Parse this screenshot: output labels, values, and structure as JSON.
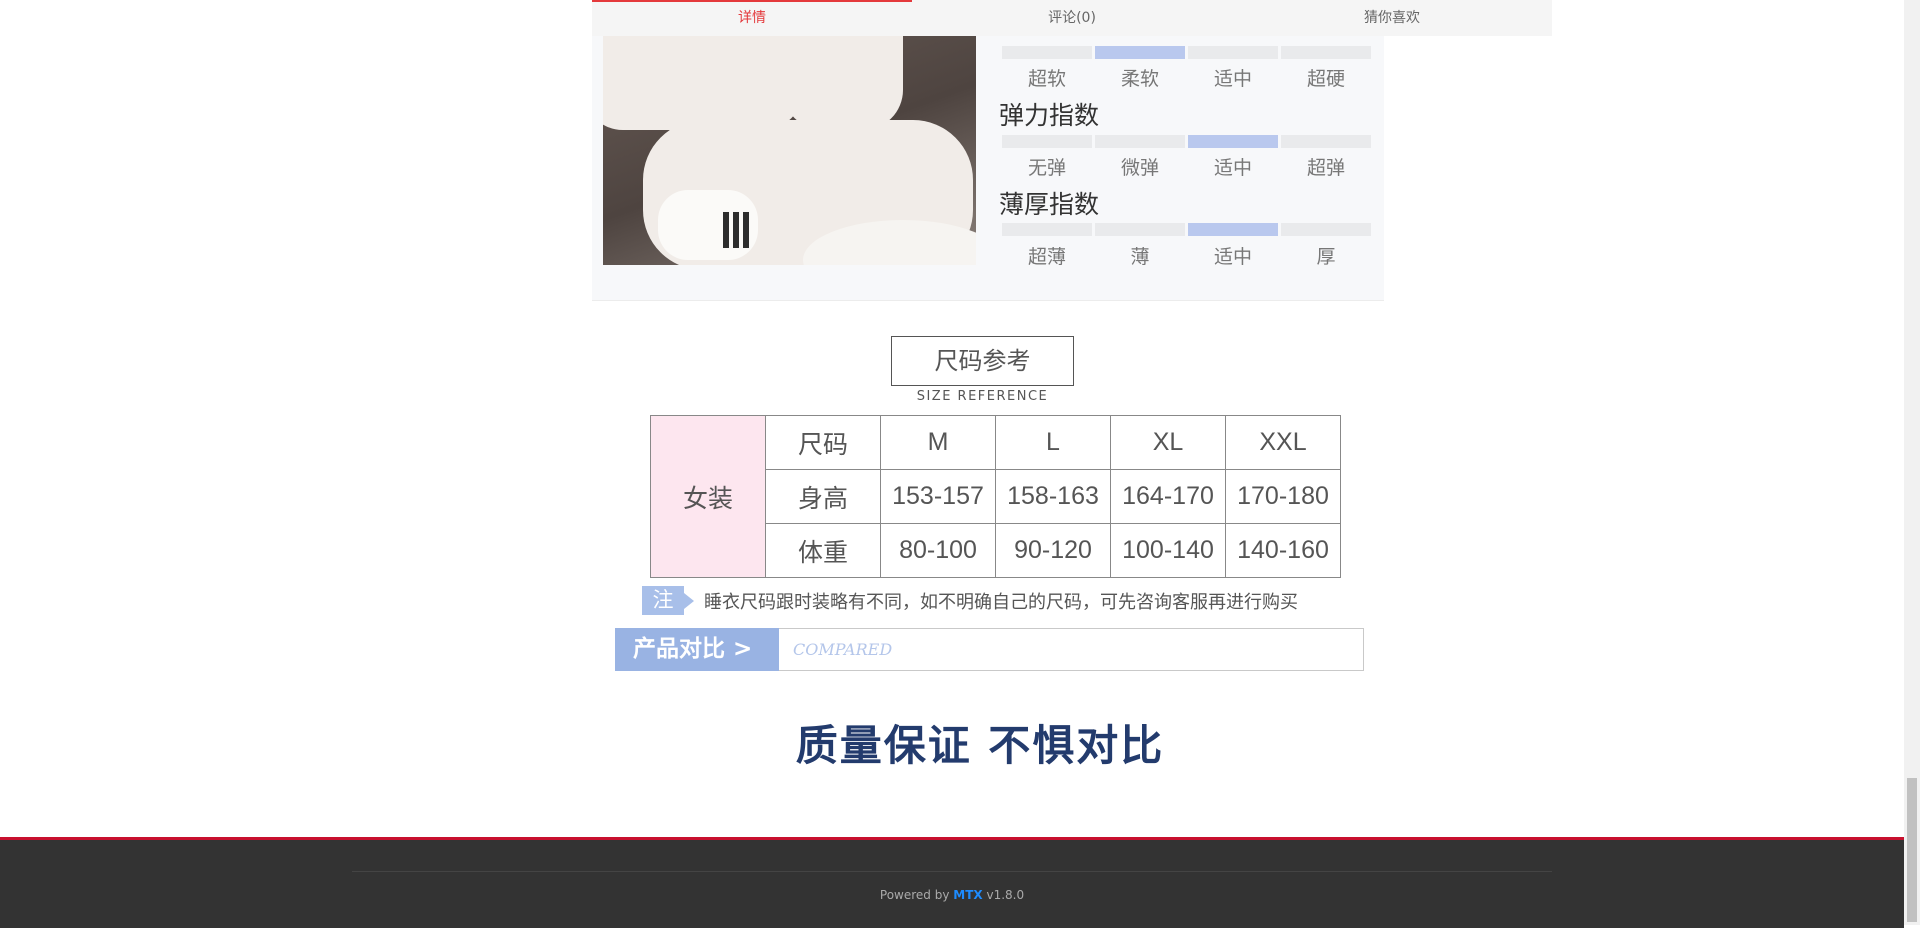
{
  "tabs": [
    {
      "label": "详情",
      "active": true
    },
    {
      "label": "评论(0)",
      "active": false
    },
    {
      "label": "猜你喜欢",
      "active": false
    }
  ],
  "indices": [
    {
      "title": "",
      "levels": [
        "超软",
        "柔软",
        "适中",
        "超硬"
      ],
      "selected": 1
    },
    {
      "title": "弹力指数",
      "levels": [
        "无弹",
        "微弹",
        "适中",
        "超弹"
      ],
      "selected": 2
    },
    {
      "title": "薄厚指数",
      "levels": [
        "超薄",
        "薄",
        "适中",
        "厚"
      ],
      "selected": 2
    }
  ],
  "size_reference": {
    "title": "尺码参考",
    "subtitle": "SIZE REFERENCE",
    "category": "女装",
    "header": [
      "尺码",
      "M",
      "L",
      "XL",
      "XXL"
    ],
    "rows": [
      [
        "身高",
        "153-157",
        "158-163",
        "164-170",
        "170-180"
      ],
      [
        "体重",
        "80-100",
        "90-120",
        "100-140",
        "140-160"
      ]
    ]
  },
  "note": {
    "tag": "注",
    "text": "睡衣尺码跟时装略有不同，如不明确自己的尺码，可先咨询客服再进行购买"
  },
  "compare": {
    "label": "产品对比 >",
    "en": "COMPARED"
  },
  "slogan": "质量保证  不惧对比",
  "footer": {
    "prefix": "Powered by ",
    "brand": "MTX",
    "version": " v1.8.0"
  },
  "colors": {
    "accent": "#e4393c",
    "bar_on": "#b9c8ee",
    "compare": "#99b3e3",
    "footer_bg": "#333333"
  }
}
